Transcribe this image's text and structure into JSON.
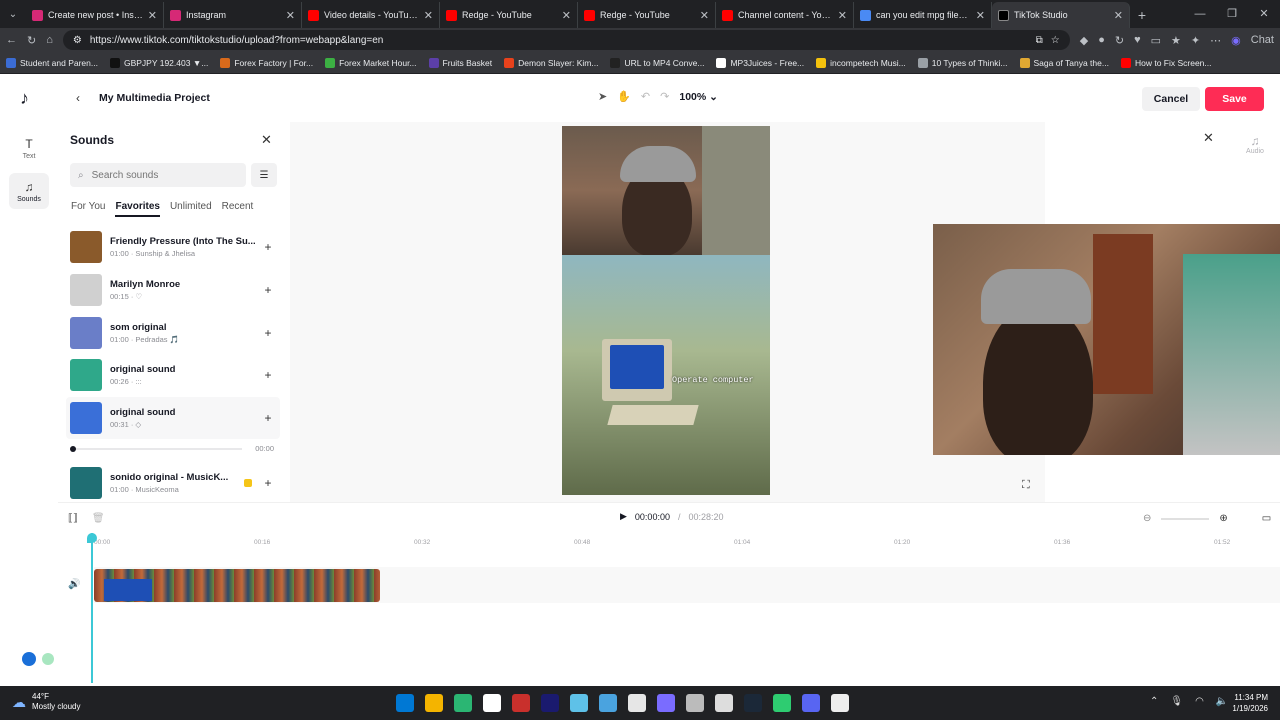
{
  "browser": {
    "tabs": [
      {
        "title": "Create new post • Instagram",
        "color": "#d62976",
        "active": false
      },
      {
        "title": "Instagram",
        "color": "#d62976",
        "active": false
      },
      {
        "title": "Video details - YouTube Stud",
        "color": "#ff0000",
        "active": false
      },
      {
        "title": "Redge - YouTube",
        "color": "#ff0000",
        "active": false
      },
      {
        "title": "Redge - YouTube",
        "color": "#ff0000",
        "active": false
      },
      {
        "title": "Channel content - YouTube",
        "color": "#ff0000",
        "active": false
      },
      {
        "title": "can you edit mpg files on ca",
        "color": "#4a8af4",
        "active": false
      },
      {
        "title": "TikTok Studio",
        "color": "#000000",
        "active": true
      }
    ],
    "url": "https://www.tiktok.com/tiktokstudio/upload?from=webapp&lang=en",
    "chat_label": "Chat",
    "bookmarks": [
      {
        "label": "Student and Paren...",
        "color": "#3b6cd4"
      },
      {
        "label": "GBPJPY 192.403 ▼...",
        "color": "#111111"
      },
      {
        "label": "Forex Factory | For...",
        "color": "#d96a1b"
      },
      {
        "label": "Forex Market Hour...",
        "color": "#3cb043"
      },
      {
        "label": "Fruits Basket",
        "color": "#5c3fa8"
      },
      {
        "label": "Demon Slayer: Kim...",
        "color": "#e8421c"
      },
      {
        "label": "URL to MP4 Conve...",
        "color": "#222222"
      },
      {
        "label": "MP3Juices - Free...",
        "color": "#ffffff"
      },
      {
        "label": "incompetech Musi...",
        "color": "#f4c20d"
      },
      {
        "label": "10 Types of Thinki...",
        "color": "#9aa0a6"
      },
      {
        "label": "Saga of Tanya the...",
        "color": "#e0a832"
      },
      {
        "label": "How to Fix Screen...",
        "color": "#ff0000"
      }
    ]
  },
  "app": {
    "project_title": "My Multimedia Project",
    "zoom": "100%",
    "cancel_label": "Cancel",
    "save_label": "Save",
    "accent": "#fe2c55",
    "rail": [
      {
        "label": "Text",
        "icon": "text-icon"
      },
      {
        "label": "Sounds",
        "icon": "music-note-icon"
      }
    ],
    "right_rail_label": "Audio"
  },
  "sounds_panel": {
    "title": "Sounds",
    "search_placeholder": "Search sounds",
    "tabs": [
      "For You",
      "Favorites",
      "Unlimited",
      "Recent"
    ],
    "active_tab": "Favorites",
    "items": [
      {
        "title": "Friendly Pressure (Into The Su...",
        "meta": "01:00 · Sunship & Jhelisa",
        "thumb": "#8a5a2b"
      },
      {
        "title": "Marilyn Monroe",
        "meta": "00:15 · ♡",
        "thumb": "#d0d0d0"
      },
      {
        "title": "som original",
        "meta": "01:00 · Pedradas 🎵",
        "thumb": "#6a7ec8"
      },
      {
        "title": "original sound",
        "meta": "00:26 · :::",
        "thumb": "#2fa88a"
      },
      {
        "title": "original sound",
        "meta": "00:31 · ◇",
        "thumb": "#3a6fd8"
      },
      {
        "title": "sonido original - MusicK...",
        "meta": "01:00 · MusicKeoma",
        "thumb": "#1f6f74"
      }
    ],
    "player": {
      "time": "00:00",
      "progress": 0.0
    }
  },
  "canvas": {
    "overlay_text": "Operate computer"
  },
  "timeline": {
    "current_time": "00:00:00",
    "separator": "/",
    "total_time": "00:28:20",
    "ticks": [
      "00:00",
      "00:16",
      "00:32",
      "00:48",
      "01:04",
      "01:20",
      "01:36",
      "01:52"
    ]
  },
  "taskbar": {
    "temperature": "44°F",
    "weather": "Mostly cloudy",
    "time": "11:34 PM",
    "date": "1/19/2026",
    "apps": [
      "#0078d4",
      "#f4b400",
      "#2bb673",
      "#ffffff",
      "#c9302c",
      "#1a1a6e",
      "#5ec1e8",
      "#4aa3df",
      "#e6e6e6",
      "#7a6cff",
      "#bbbbbb",
      "#dddddd",
      "#1b2838",
      "#2ecc71",
      "#5865f2",
      "#eeeeee"
    ]
  }
}
